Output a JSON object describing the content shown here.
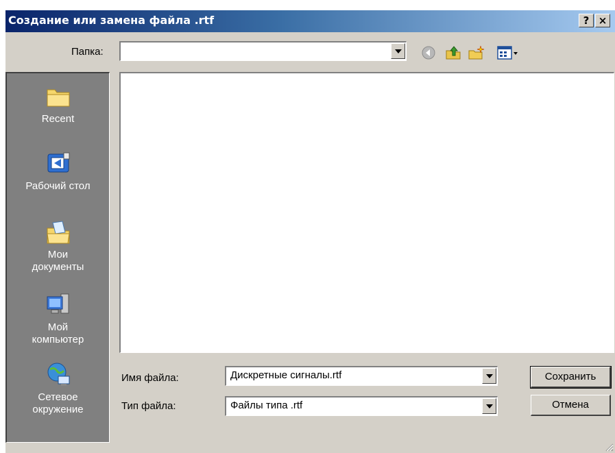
{
  "dialog": {
    "title": "Создание или замена файла .rtf",
    "help_label": "?",
    "close_label": "×"
  },
  "toolbar": {
    "look_in_label": "Папка:",
    "look_in_value": "",
    "icons": [
      "back-icon",
      "up-folder-icon",
      "new-folder-icon",
      "view-menu-icon"
    ]
  },
  "places": [
    {
      "label": "Recent",
      "icon": "recent-folder-icon"
    },
    {
      "label": "Рабочий стол",
      "icon": "desktop-icon"
    },
    {
      "label": "Мои\nдокументы",
      "icon": "my-documents-icon"
    },
    {
      "label": "Мой\nкомпьютер",
      "icon": "my-computer-icon"
    },
    {
      "label": "Сетевое\nокружение",
      "icon": "network-icon"
    }
  ],
  "filename": {
    "label": "Имя файла:",
    "value": "Дискретные сигналы.rtf"
  },
  "filetype": {
    "label": "Тип файла:",
    "value": "Файлы типа .rtf"
  },
  "buttons": {
    "save": "Сохранить",
    "cancel": "Отмена"
  },
  "colors": {
    "titlebar_start": "#0a246a",
    "titlebar_end": "#a6caf0",
    "face": "#d4d0c8",
    "places_bar": "#808080"
  }
}
